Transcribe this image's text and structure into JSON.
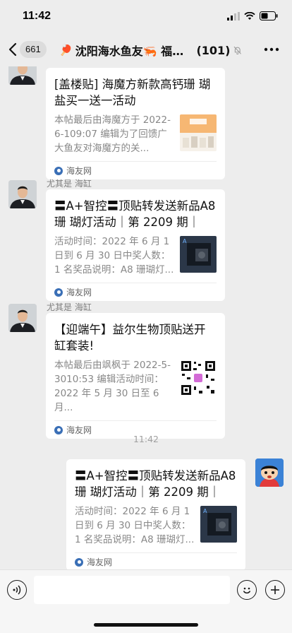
{
  "status_bar": {
    "time": "11:42"
  },
  "nav": {
    "unread_count": "661",
    "title_emoji_left": "🏓",
    "title": "沈阳海水鱼友🦐 福利群",
    "member_count": "(101)"
  },
  "messages": [
    {
      "sender": "",
      "title": "[盖楼贴] 海魔方新款高钙珊 瑚盐买一送一活动",
      "desc": "本帖最后由海魔方于 2022-6-109:07 编辑为了回馈广大鱼友对海魔方的关...",
      "source": "海友网",
      "thumb_icon": "salt-product-thumbnail"
    },
    {
      "sender": "尤其是 海缸",
      "title": "〓A+智控〓顶贴转发送新品A8 珊 瑚灯活动｜第 2209 期｜",
      "desc": "活动时间：2022 年 6 月 1 日到 6 月 30 日中奖人数：1 名奖品说明：A8 珊瑚灯...",
      "source": "海友网",
      "thumb_icon": "coral-lamp-thumbnail"
    },
    {
      "sender": "尤其是 海缸",
      "title": "【迎端午】益尔生物顶贴送开缸套装!",
      "desc": "本帖最后由飒枫于 2022-5-3010:53 编辑活动时间：2022 年 5 月 30 日至 6 月...",
      "source": "海友网",
      "thumb_icon": "qr-code-thumbnail"
    }
  ],
  "timestamp": "11:42",
  "my_message": {
    "title": "〓A+智控〓顶贴转发送新品A8 珊 瑚灯活动｜第 2209 期｜",
    "desc": "活动时间：2022 年 6 月 1 日到 6 月 30 日中奖人数：1 名奖品说明：A8 珊瑚灯...",
    "source": "海友网",
    "thumb_icon": "coral-lamp-thumbnail"
  }
}
